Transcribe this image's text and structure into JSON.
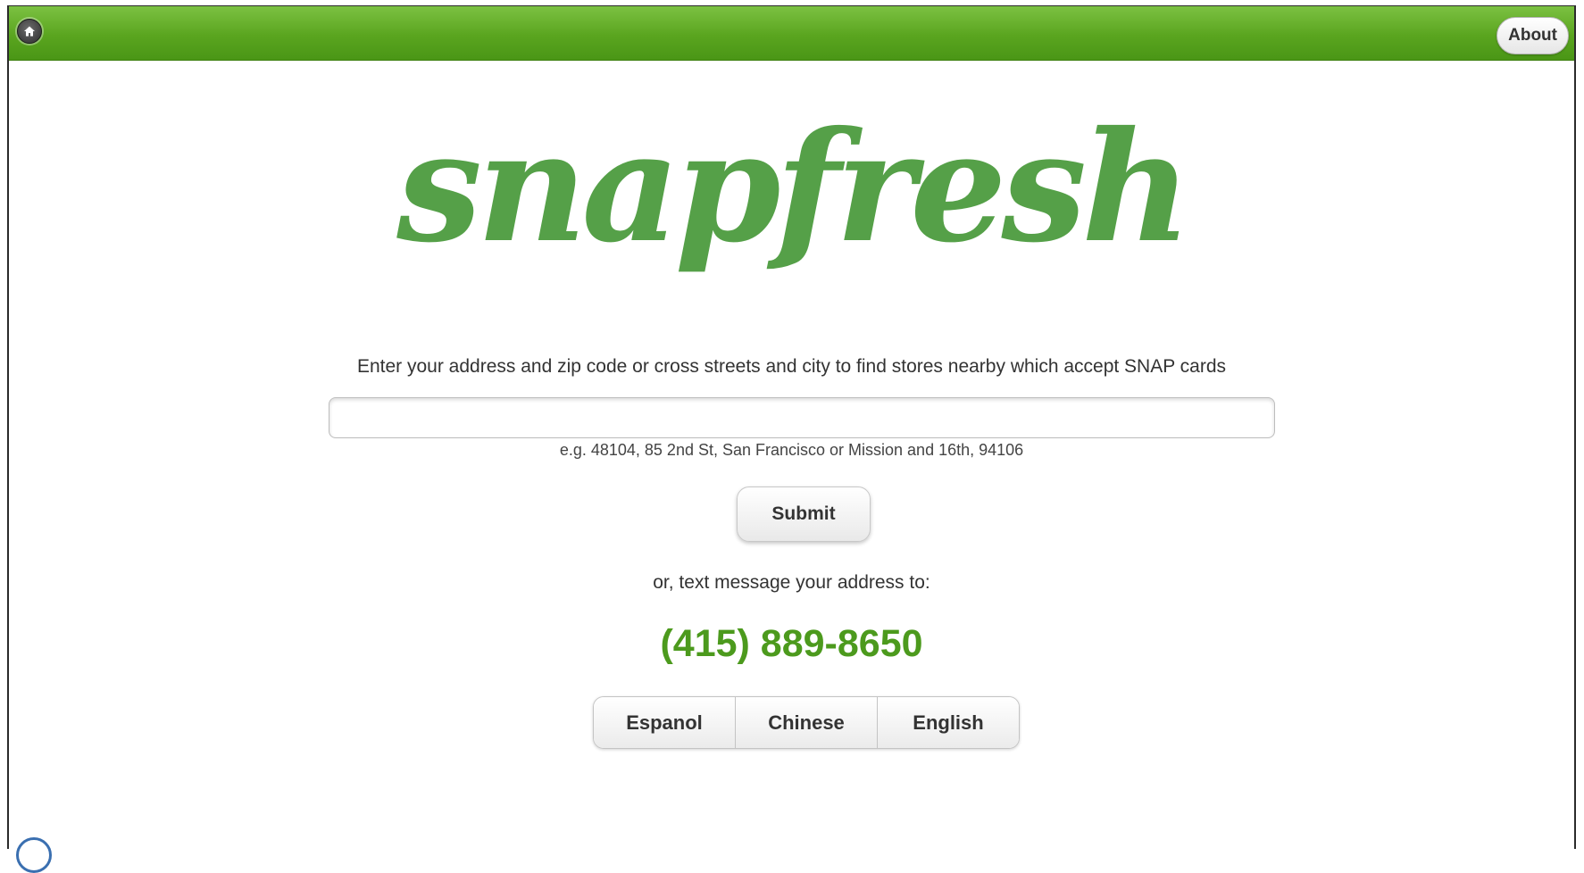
{
  "header": {
    "home_icon": "home-icon",
    "about_label": "About",
    "bar_color": "#5aa51f"
  },
  "logo": {
    "text": "snapfresh",
    "color": "#55a048"
  },
  "main": {
    "instructions": "Enter your address and zip code or cross streets and city to find stores nearby which accept SNAP cards",
    "address_value": "",
    "address_placeholder": "",
    "hint": "e.g. 48104, 85 2nd St, San Francisco or Mission and 16th, 94106",
    "submit_label": "Submit",
    "sms_text": "or, text message your address to:",
    "phone": "(415) 889-8650",
    "phone_color": "#4c9a1d"
  },
  "languages": [
    {
      "label": "Espanol"
    },
    {
      "label": "Chinese"
    },
    {
      "label": "English"
    }
  ]
}
